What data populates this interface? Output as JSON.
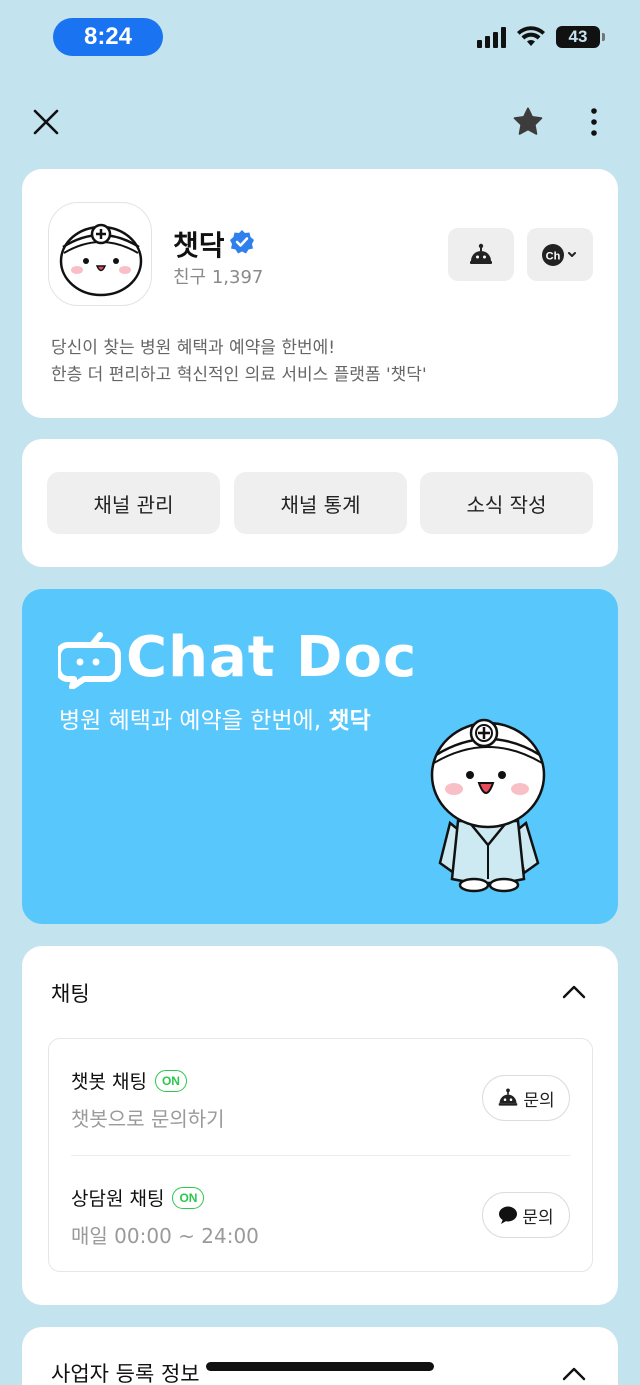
{
  "status_bar": {
    "time": "8:24",
    "battery": "43"
  },
  "profile": {
    "name": "챗닥",
    "friends": "친구 1,397",
    "description_line1": "당신이 찾는 병원 혜택과 예약을 한번에!",
    "description_line2": "한층 더 편리하고 혁신적인 의료 서비스 플랫폼 '챗닥'"
  },
  "actions": {
    "manage": "채널 관리",
    "stats": "채널 통계",
    "write_news": "소식 작성"
  },
  "banner": {
    "title": "Chat Doc",
    "subtitle_prefix": "병원 혜택과 예약을 한번에, ",
    "subtitle_bold": "챗닥",
    "color": "#58c7fb"
  },
  "chat": {
    "section_title": "채팅",
    "rows": [
      {
        "title": "챗봇 채팅",
        "badge": "ON",
        "subtitle": "챗봇으로 문의하기",
        "button": "문의",
        "icon": "bot-icon"
      },
      {
        "title": "상담원 채팅",
        "badge": "ON",
        "subtitle": "매일 00:00 ~ 24:00",
        "button": "문의",
        "icon": "speech-bubble-icon"
      }
    ]
  },
  "business": {
    "section_title": "사업자 등록 정보"
  },
  "colors": {
    "background": "#c3e3ef",
    "verified": "#2f80ed",
    "on_badge": "#2bc74e"
  }
}
